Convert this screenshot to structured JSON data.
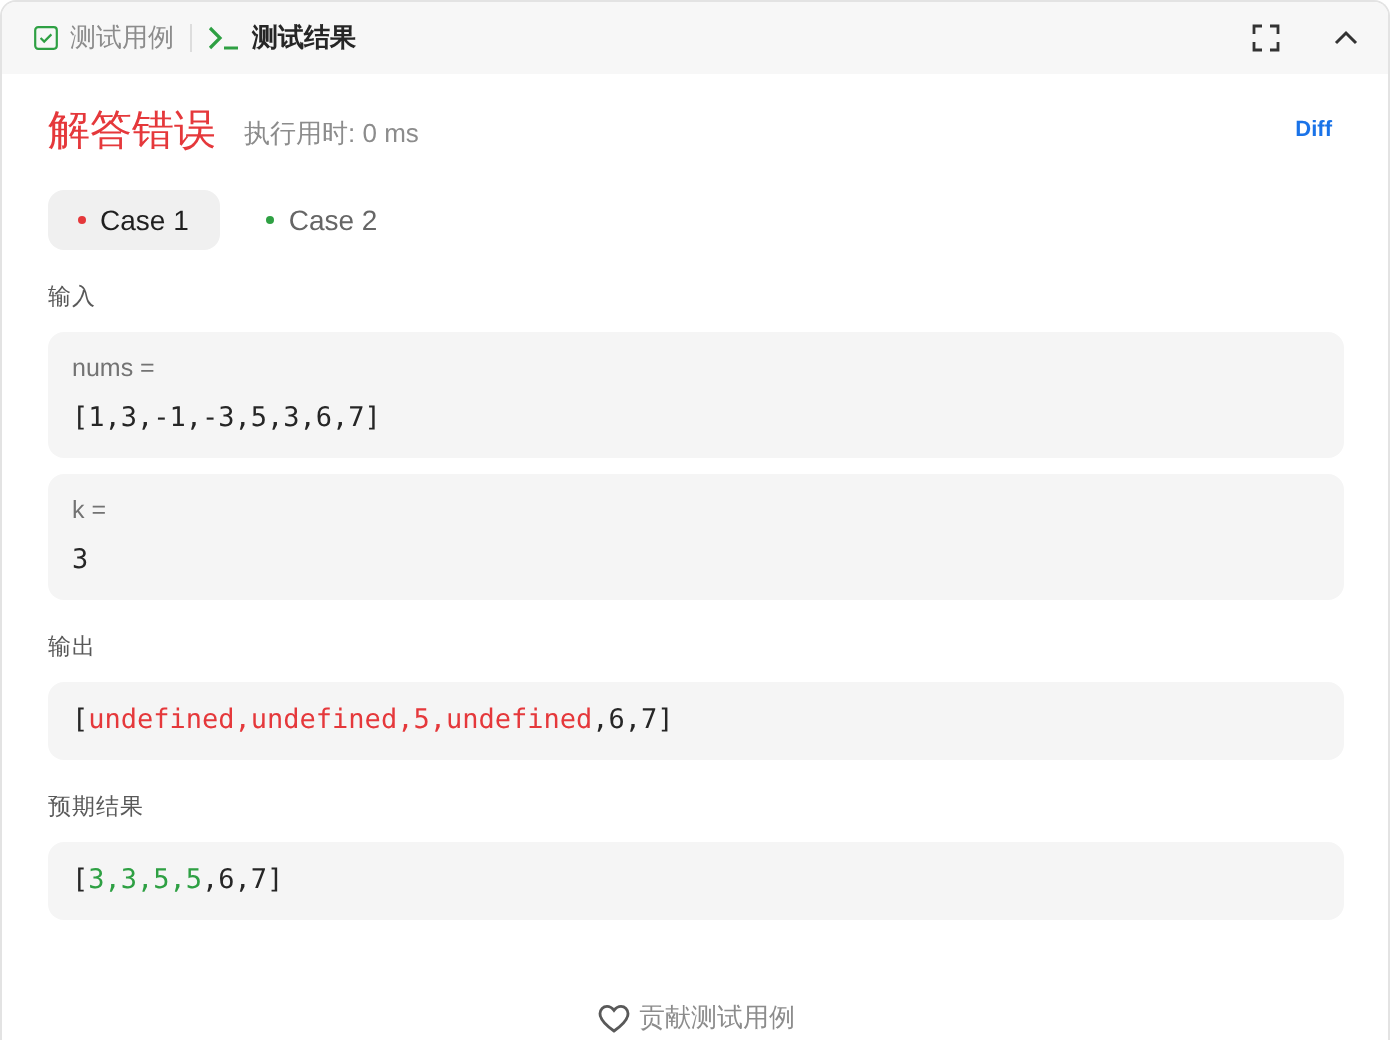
{
  "header": {
    "tabs": [
      {
        "label": "测试用例",
        "kind": "checkbox",
        "selected": false
      },
      {
        "label": "测试结果",
        "kind": "terminal",
        "selected": true
      }
    ]
  },
  "verdict": {
    "title": "解答错误",
    "runtime": "执行用时: 0 ms",
    "diff_link": "Diff"
  },
  "cases": [
    {
      "label": "Case 1",
      "color": "#e5383b",
      "selected": true
    },
    {
      "label": "Case 2",
      "color": "#2ea043",
      "selected": false
    }
  ],
  "input": {
    "label": "输入",
    "params": [
      {
        "name": "nums =",
        "value": "[1,3,-1,-3,5,3,6,7]"
      },
      {
        "name": "k =",
        "value": "3"
      }
    ]
  },
  "output": {
    "label": "输出",
    "kind": "actual",
    "segments": [
      {
        "text": "[",
        "diff": false
      },
      {
        "text": "undefined,undefined,5,undefined",
        "diff": true
      },
      {
        "text": ",6,7]",
        "diff": false
      }
    ]
  },
  "expected": {
    "label": "预期结果",
    "kind": "expected",
    "segments": [
      {
        "text": "[",
        "diff": false
      },
      {
        "text": "3,3,5,5",
        "diff": true
      },
      {
        "text": ",6,7]",
        "diff": false
      }
    ]
  },
  "contribute": "贡献测试用例"
}
